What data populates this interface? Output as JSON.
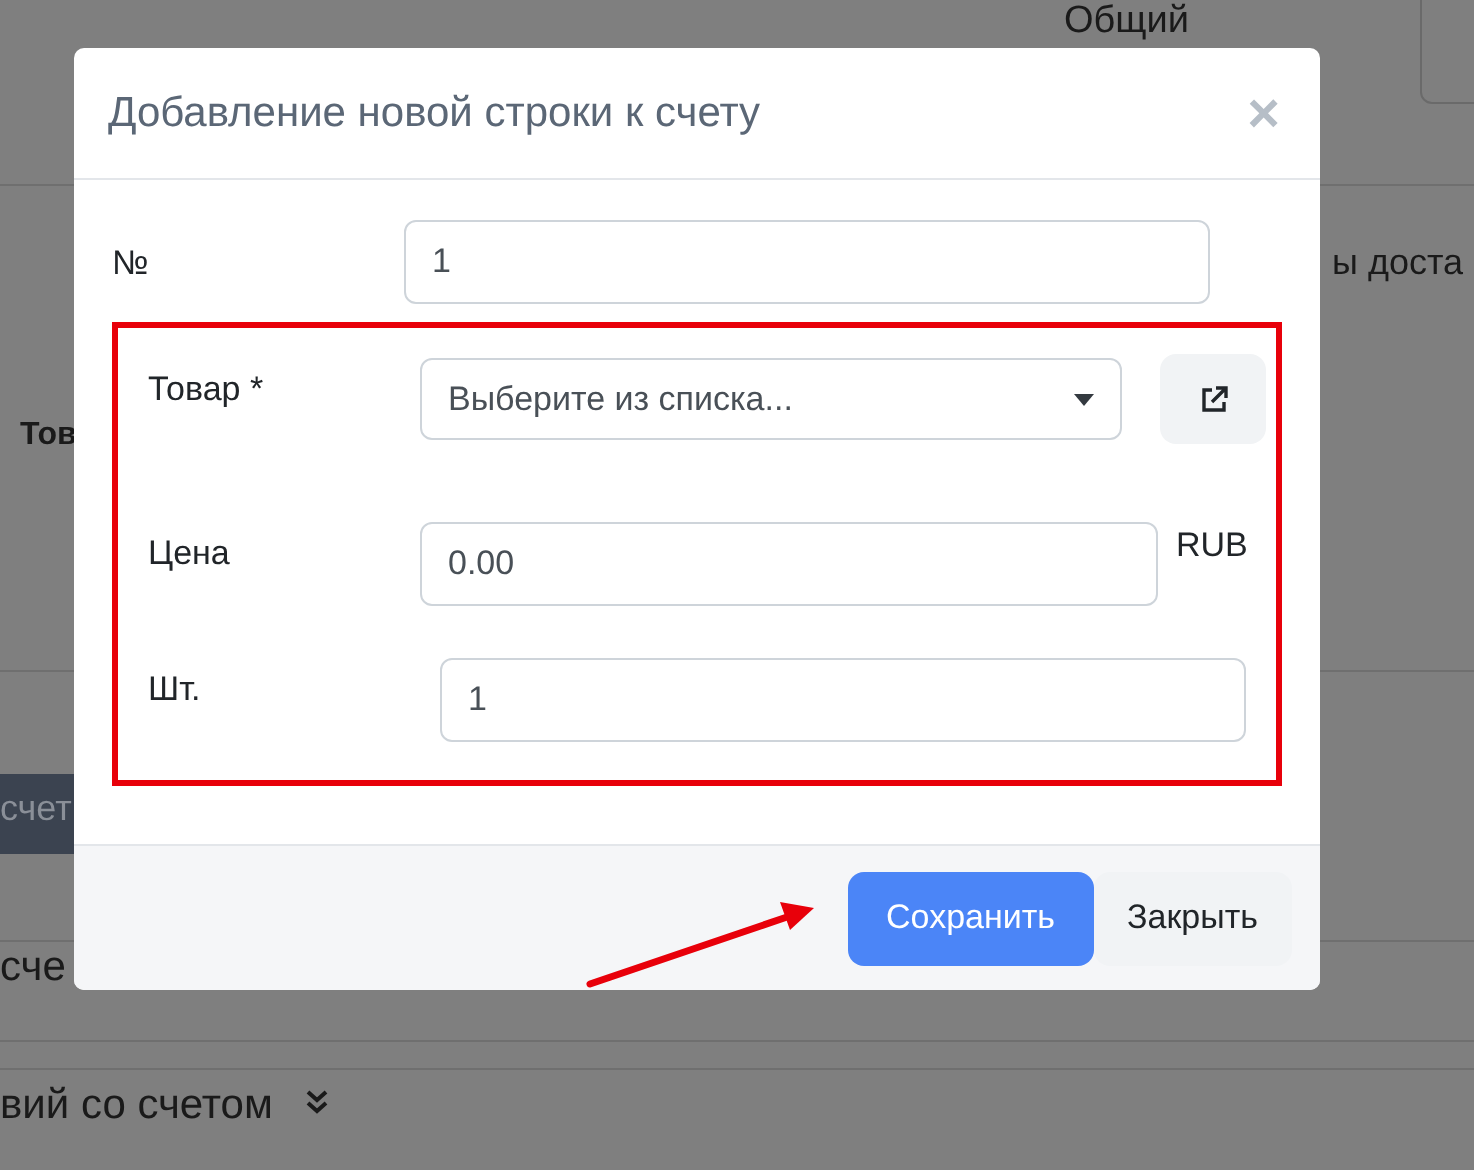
{
  "background": {
    "texts": [
      "Общий",
      "ы доста",
      "Тов",
      "счет",
      "сче",
      "вий со счетом"
    ]
  },
  "modal": {
    "title": "Добавление новой строки к счету",
    "close": "×",
    "fields": [
      {
        "label": "№",
        "kind": "text",
        "value": "1",
        "highlighted": false
      },
      {
        "label": "Товар *",
        "kind": "select",
        "value": "Выберите из списка...",
        "highlighted": true
      },
      {
        "label": "Цена",
        "kind": "currency",
        "value": "0.00",
        "unit": "RUB",
        "highlighted": true
      },
      {
        "label": "Шт.",
        "kind": "text",
        "value": "1",
        "highlighted": true
      }
    ],
    "buttons": [
      {
        "label": "Сохранить",
        "kind": "primary",
        "highlighted": true
      },
      {
        "label": "Закрыть",
        "kind": "secondary"
      }
    ]
  }
}
